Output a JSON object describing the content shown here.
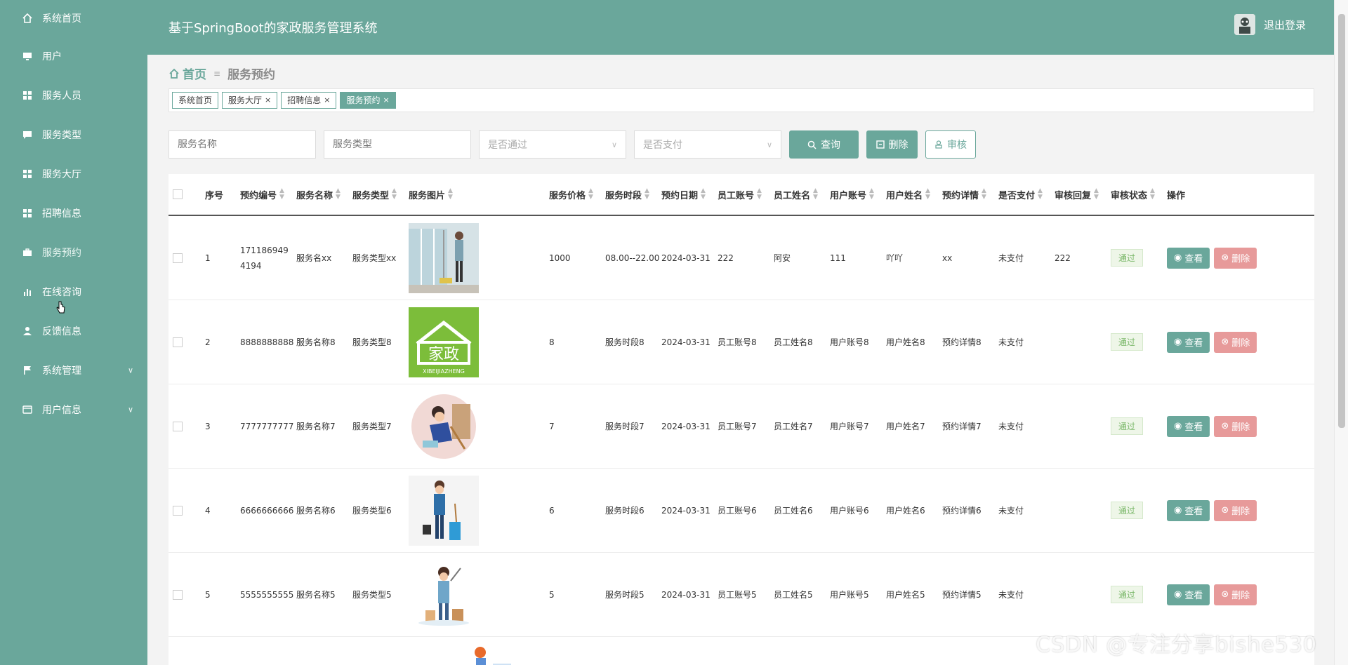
{
  "app": {
    "title": "基于SpringBoot的家政服务管理系统",
    "logout": "退出登录"
  },
  "sidebar": {
    "items": [
      {
        "label": "系统首页",
        "icon": "home-icon"
      },
      {
        "label": "用户",
        "icon": "monitor-icon"
      },
      {
        "label": "服务人员",
        "icon": "grid-icon"
      },
      {
        "label": "服务类型",
        "icon": "chat-icon"
      },
      {
        "label": "服务大厅",
        "icon": "grid-icon"
      },
      {
        "label": "招聘信息",
        "icon": "grid-icon"
      },
      {
        "label": "服务预约",
        "icon": "briefcase-icon"
      },
      {
        "label": "在线咨询",
        "icon": "bar-chart-icon"
      },
      {
        "label": "反馈信息",
        "icon": "user-icon"
      },
      {
        "label": "系统管理",
        "icon": "flag-icon",
        "expandable": true
      },
      {
        "label": "用户信息",
        "icon": "card-icon",
        "expandable": true
      }
    ]
  },
  "breadcrumb": {
    "home": "首页",
    "current": "服务预约"
  },
  "tags": [
    {
      "label": "系统首页",
      "closable": false,
      "active": false
    },
    {
      "label": "服务大厅",
      "closable": true,
      "active": false
    },
    {
      "label": "招聘信息",
      "closable": true,
      "active": false
    },
    {
      "label": "服务预约",
      "closable": true,
      "active": true
    }
  ],
  "filters": {
    "service_name_placeholder": "服务名称",
    "service_type_placeholder": "服务类型",
    "passed_placeholder": "是否通过",
    "paid_placeholder": "是否支付",
    "query_label": "查询",
    "delete_label": "删除",
    "audit_label": "审核"
  },
  "table": {
    "headers": [
      "序号",
      "预约编号",
      "服务名称",
      "服务类型",
      "服务图片",
      "服务价格",
      "服务时段",
      "预约日期",
      "员工账号",
      "员工姓名",
      "用户账号",
      "用户姓名",
      "预约详情",
      "是否支付",
      "审核回复",
      "审核状态",
      "操作"
    ],
    "view_label": "查看",
    "delete_label": "删除",
    "rows": [
      {
        "idx": "1",
        "no": "1711869494194",
        "name": "服务名xx",
        "type": "服务类型xx",
        "price": "1000",
        "period": "08.00--22.00",
        "date": "2024-03-31",
        "emp_acc": "222",
        "emp_name": "阿安",
        "user_acc": "111",
        "user_name": "吖吖",
        "detail": "xx",
        "paid": "未支付",
        "reply": "222",
        "status": "通过",
        "img": "cleaner-window"
      },
      {
        "idx": "2",
        "no": "8888888888",
        "name": "服务名称8",
        "type": "服务类型8",
        "price": "8",
        "period": "服务时段8",
        "date": "2024-03-31",
        "emp_acc": "员工账号8",
        "emp_name": "员工姓名8",
        "user_acc": "用户账号8",
        "user_name": "用户姓名8",
        "detail": "预约详情8",
        "paid": "未支付",
        "reply": "",
        "status": "通过",
        "img": "jiazheng-logo"
      },
      {
        "idx": "3",
        "no": "7777777777",
        "name": "服务名称7",
        "type": "服务类型7",
        "price": "7",
        "period": "服务时段7",
        "date": "2024-03-31",
        "emp_acc": "员工账号7",
        "emp_name": "员工姓名7",
        "user_acc": "用户账号7",
        "user_name": "用户姓名7",
        "detail": "预约详情7",
        "paid": "未支付",
        "reply": "",
        "status": "通过",
        "img": "cleaner-circle"
      },
      {
        "idx": "4",
        "no": "6666666666",
        "name": "服务名称6",
        "type": "服务类型6",
        "price": "6",
        "period": "服务时段6",
        "date": "2024-03-31",
        "emp_acc": "员工账号6",
        "emp_name": "员工姓名6",
        "user_acc": "用户账号6",
        "user_name": "用户姓名6",
        "detail": "预约详情6",
        "paid": "未支付",
        "reply": "",
        "status": "通过",
        "img": "cleaner-bucket"
      },
      {
        "idx": "5",
        "no": "5555555555",
        "name": "服务名称5",
        "type": "服务类型5",
        "price": "5",
        "period": "服务时段5",
        "date": "2024-03-31",
        "emp_acc": "员工账号5",
        "emp_name": "员工姓名5",
        "user_acc": "用户账号5",
        "user_name": "用户姓名5",
        "detail": "预约详情5",
        "paid": "未支付",
        "reply": "",
        "status": "通过",
        "img": "cleaner-tools"
      }
    ]
  },
  "watermark": "CSDN @专注分享bishe530",
  "colors": {
    "primary": "#6aa79b",
    "danger": "#e79a9a",
    "status_ok": "#7bb86a",
    "logo_green": "#7cbd3a"
  }
}
